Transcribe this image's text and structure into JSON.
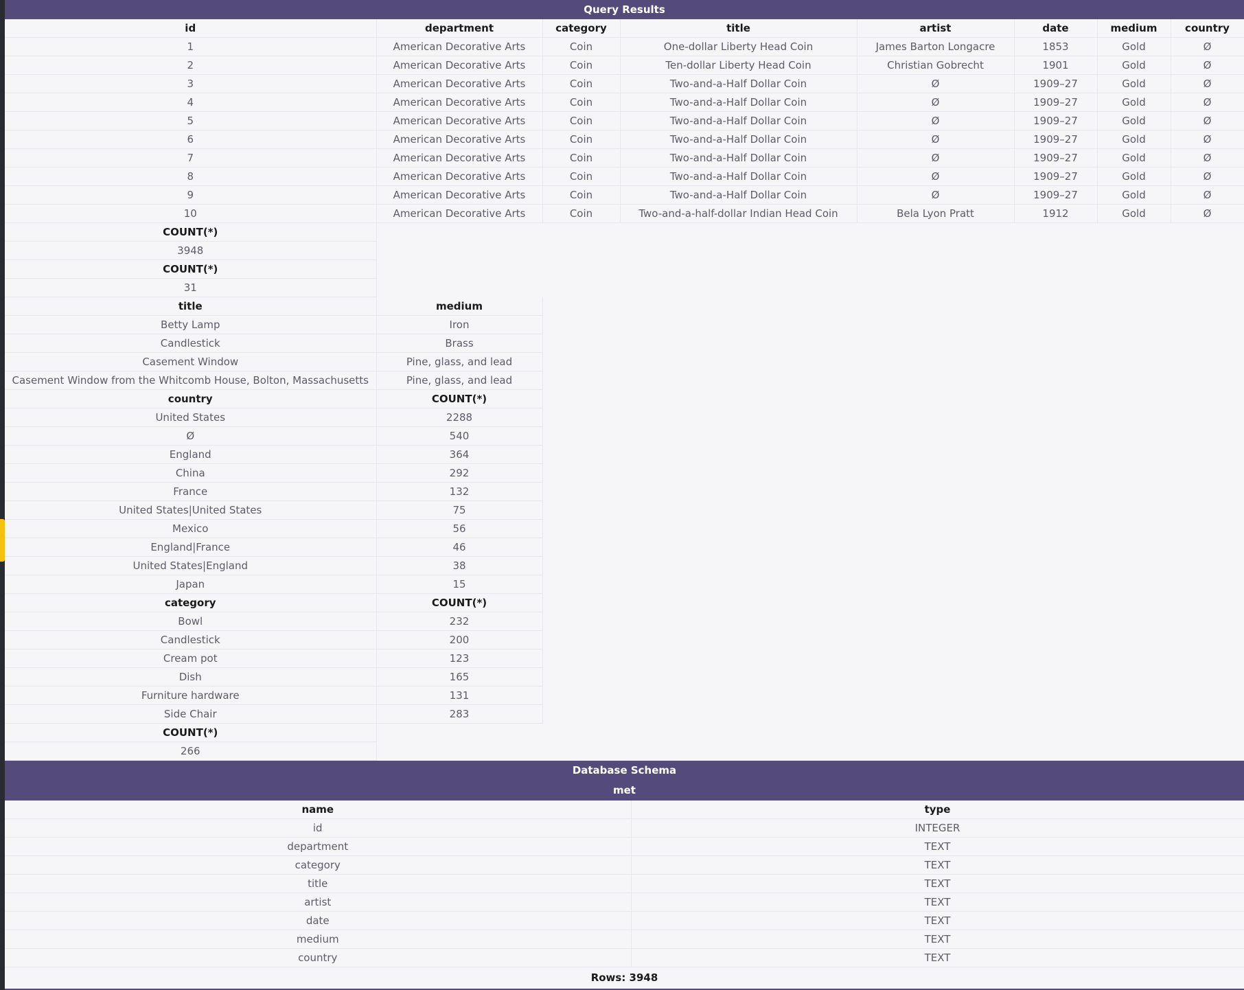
{
  "header": {
    "title": "Query Results"
  },
  "result1": {
    "columns": [
      "id",
      "department",
      "category",
      "title",
      "artist",
      "date",
      "medium",
      "country"
    ],
    "rows": [
      [
        "1",
        "American Decorative Arts",
        "Coin",
        "One-dollar Liberty Head Coin",
        "James Barton Longacre",
        "1853",
        "Gold",
        "Ø"
      ],
      [
        "2",
        "American Decorative Arts",
        "Coin",
        "Ten-dollar Liberty Head Coin",
        "Christian Gobrecht",
        "1901",
        "Gold",
        "Ø"
      ],
      [
        "3",
        "American Decorative Arts",
        "Coin",
        "Two-and-a-Half Dollar Coin",
        "Ø",
        "1909–27",
        "Gold",
        "Ø"
      ],
      [
        "4",
        "American Decorative Arts",
        "Coin",
        "Two-and-a-Half Dollar Coin",
        "Ø",
        "1909–27",
        "Gold",
        "Ø"
      ],
      [
        "5",
        "American Decorative Arts",
        "Coin",
        "Two-and-a-Half Dollar Coin",
        "Ø",
        "1909–27",
        "Gold",
        "Ø"
      ],
      [
        "6",
        "American Decorative Arts",
        "Coin",
        "Two-and-a-Half Dollar Coin",
        "Ø",
        "1909–27",
        "Gold",
        "Ø"
      ],
      [
        "7",
        "American Decorative Arts",
        "Coin",
        "Two-and-a-Half Dollar Coin",
        "Ø",
        "1909–27",
        "Gold",
        "Ø"
      ],
      [
        "8",
        "American Decorative Arts",
        "Coin",
        "Two-and-a-Half Dollar Coin",
        "Ø",
        "1909–27",
        "Gold",
        "Ø"
      ],
      [
        "9",
        "American Decorative Arts",
        "Coin",
        "Two-and-a-Half Dollar Coin",
        "Ø",
        "1909–27",
        "Gold",
        "Ø"
      ],
      [
        "10",
        "American Decorative Arts",
        "Coin",
        "Two-and-a-half-dollar Indian Head Coin",
        "Bela Lyon Pratt",
        "1912",
        "Gold",
        "Ø"
      ]
    ]
  },
  "result2": {
    "columns": [
      "COUNT(*)"
    ],
    "rows": [
      [
        "3948"
      ]
    ]
  },
  "result3": {
    "columns": [
      "COUNT(*)"
    ],
    "rows": [
      [
        "31"
      ]
    ]
  },
  "result4": {
    "columns": [
      "title",
      "medium"
    ],
    "rows": [
      [
        "Betty Lamp",
        "Iron"
      ],
      [
        "Candlestick",
        "Brass"
      ],
      [
        "Casement Window",
        "Pine, glass, and lead"
      ],
      [
        "Casement Window from the Whitcomb House, Bolton, Massachusetts",
        "Pine, glass, and lead"
      ]
    ]
  },
  "result5": {
    "columns": [
      "country",
      "COUNT(*)"
    ],
    "rows": [
      [
        "United States",
        "2288"
      ],
      [
        "Ø",
        "540"
      ],
      [
        "England",
        "364"
      ],
      [
        "China",
        "292"
      ],
      [
        "France",
        "132"
      ],
      [
        "United States|United States",
        "75"
      ],
      [
        "Mexico",
        "56"
      ],
      [
        "England|France",
        "46"
      ],
      [
        "United States|England",
        "38"
      ],
      [
        "Japan",
        "15"
      ]
    ]
  },
  "result6": {
    "columns": [
      "category",
      "COUNT(*)"
    ],
    "rows": [
      [
        "Bowl",
        "232"
      ],
      [
        "Candlestick",
        "200"
      ],
      [
        "Cream pot",
        "123"
      ],
      [
        "Dish",
        "165"
      ],
      [
        "Furniture hardware",
        "131"
      ],
      [
        "Side Chair",
        "283"
      ]
    ]
  },
  "result7": {
    "columns": [
      "COUNT(*)"
    ],
    "rows": [
      [
        "266"
      ]
    ]
  },
  "schema": {
    "title": "Database Schema",
    "table_name": "met",
    "columns": [
      "name",
      "type"
    ],
    "rows": [
      [
        "id",
        "INTEGER"
      ],
      [
        "department",
        "TEXT"
      ],
      [
        "category",
        "TEXT"
      ],
      [
        "title",
        "TEXT"
      ],
      [
        "artist",
        "TEXT"
      ],
      [
        "date",
        "TEXT"
      ],
      [
        "medium",
        "TEXT"
      ],
      [
        "country",
        "TEXT"
      ]
    ]
  },
  "footer": {
    "rows_label": "Rows: 3948"
  },
  "colors": {
    "header_bg": "#544b7b",
    "page_bg": "#f6f6f9",
    "accent": "#f4c20d"
  }
}
